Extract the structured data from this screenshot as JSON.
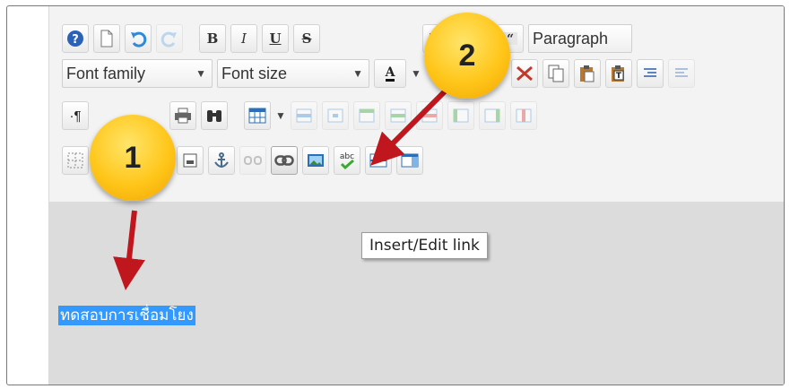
{
  "toolbar": {
    "row1": {
      "help": "help-icon",
      "new_document": "new-document-icon",
      "undo": "undo-icon",
      "redo": "redo-icon",
      "bold": "B",
      "italic": "I",
      "underline": "U",
      "strikethrough": "S",
      "align_left": "align-left-icon",
      "align_right": "align-right-icon",
      "blockquote": "blockquote-icon",
      "format_select": "Paragraph"
    },
    "row2": {
      "font_family": "Font family",
      "font_size": "Font size",
      "text_color": "A"
    },
    "row4": {
      "spellcheck": "abc"
    }
  },
  "tooltip": "Insert/Edit link",
  "content": {
    "selected_text": "ทดสอบการเชื่อมโยง"
  },
  "markers": {
    "marker1": "1",
    "marker2": "2"
  },
  "colors": {
    "selection": "#3399ff",
    "marker": "#ffc61a",
    "arrow": "#c0161d"
  }
}
